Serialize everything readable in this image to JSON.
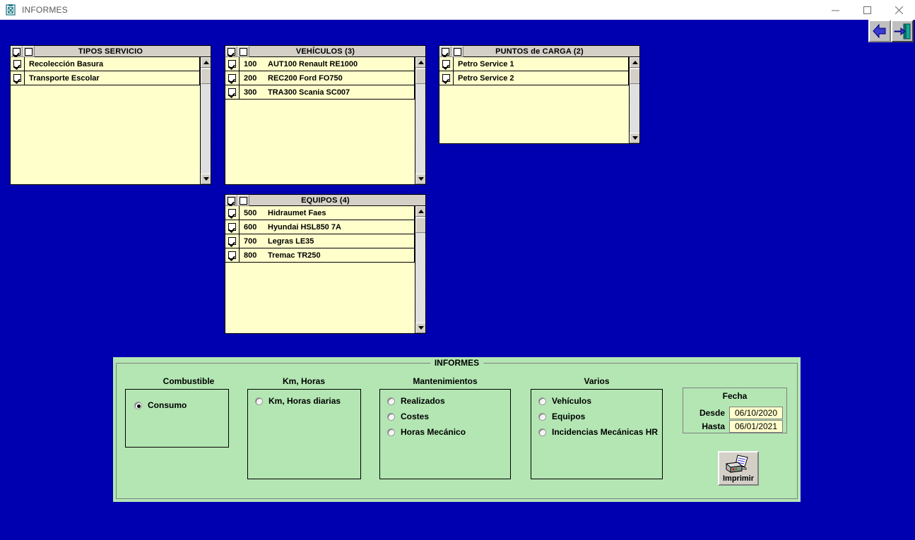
{
  "window": {
    "title": "INFORMES",
    "app_icon": "clipboard-icon",
    "minimize": "—",
    "maximize": "☐",
    "close": "✕"
  },
  "toolbar": {
    "back_label": "back-arrow-icon",
    "exit_label": "exit-door-icon"
  },
  "panels": [
    {
      "id": "tipos-servicio",
      "title": "TIPOS SERVICIO",
      "select_all_checked": true,
      "deselect_all_checked": false,
      "has_code_column": false,
      "rows": [
        {
          "checked": true,
          "code": "",
          "label": "Recolección Basura"
        },
        {
          "checked": true,
          "code": "",
          "label": "Transporte Escolar"
        }
      ]
    },
    {
      "id": "vehiculos",
      "title": "VEHÍCULOS  (3)",
      "select_all_checked": true,
      "deselect_all_checked": false,
      "has_code_column": true,
      "rows": [
        {
          "checked": true,
          "code": "100",
          "label": "AUT100 Renault RE1000"
        },
        {
          "checked": true,
          "code": "200",
          "label": "REC200 Ford FO750"
        },
        {
          "checked": true,
          "code": "300",
          "label": "TRA300 Scania SC007"
        }
      ]
    },
    {
      "id": "puntos-de-carga",
      "title": "PUNTOS  de  CARGA  (2)",
      "select_all_checked": true,
      "deselect_all_checked": false,
      "has_code_column": false,
      "rows": [
        {
          "checked": true,
          "code": "",
          "label": "Petro Service 1"
        },
        {
          "checked": true,
          "code": "",
          "label": "Petro Service 2"
        }
      ]
    },
    {
      "id": "equipos",
      "title": "EQUIPOS  (4)",
      "select_all_checked": true,
      "deselect_all_checked": false,
      "has_code_column": true,
      "rows": [
        {
          "checked": true,
          "code": "500",
          "label": "Hidraumet Faes"
        },
        {
          "checked": true,
          "code": "600",
          "label": "Hyundai HSL850 7A"
        },
        {
          "checked": true,
          "code": "700",
          "label": "Legras LE35"
        },
        {
          "checked": true,
          "code": "800",
          "label": "Tremac TR250"
        }
      ]
    }
  ],
  "informes": {
    "legend": "INFORMES",
    "groups": [
      {
        "label": "Combustible",
        "options": [
          {
            "label": "Consumo",
            "selected": true
          }
        ]
      },
      {
        "label": "Km,  Horas",
        "options": [
          {
            "label": "Km, Horas diarias",
            "selected": false
          }
        ]
      },
      {
        "label": "Mantenimientos",
        "options": [
          {
            "label": "Realizados",
            "selected": false
          },
          {
            "label": "Costes",
            "selected": false
          },
          {
            "label": "Horas Mecánico",
            "selected": false
          }
        ]
      },
      {
        "label": "Varios",
        "options": [
          {
            "label": "Vehículos",
            "selected": false
          },
          {
            "label": "Equipos",
            "selected": false
          },
          {
            "label": "Incidencias Mecánicas HR",
            "selected": false
          }
        ]
      }
    ],
    "fecha": {
      "title": "Fecha",
      "desde_label": "Desde",
      "desde_value": "06/10/2020",
      "hasta_label": "Hasta",
      "hasta_value": "06/01/2021"
    },
    "print_button": {
      "label": "Imprimir",
      "icon": "printer-icon"
    }
  },
  "colors": {
    "desktop": "#0000b0",
    "list_bg": "#ffffcc",
    "panel_green": "#b3e6b3",
    "control_face": "#d4d0c8"
  }
}
